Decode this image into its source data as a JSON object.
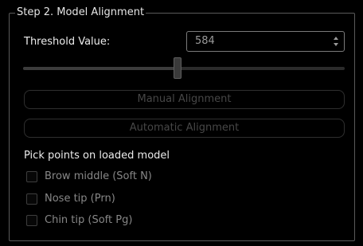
{
  "group": {
    "title": "Step 2. Model Alignment"
  },
  "threshold": {
    "label": "Threshold Value:",
    "value": "584",
    "slider_fraction": 0.48
  },
  "buttons": {
    "manual": "Manual Alignment",
    "automatic": "Automatic Alignment"
  },
  "pick": {
    "label": "Pick points on loaded model",
    "items": [
      {
        "label": "Brow middle (Soft N)",
        "checked": false
      },
      {
        "label": "Nose tip (Prn)",
        "checked": false
      },
      {
        "label": "Chin tip (Soft Pg)",
        "checked": false
      }
    ]
  },
  "colors": {
    "background": "#000000",
    "text": "#ececec",
    "disabled_text": "#474747",
    "border": "#5a5a5a"
  }
}
